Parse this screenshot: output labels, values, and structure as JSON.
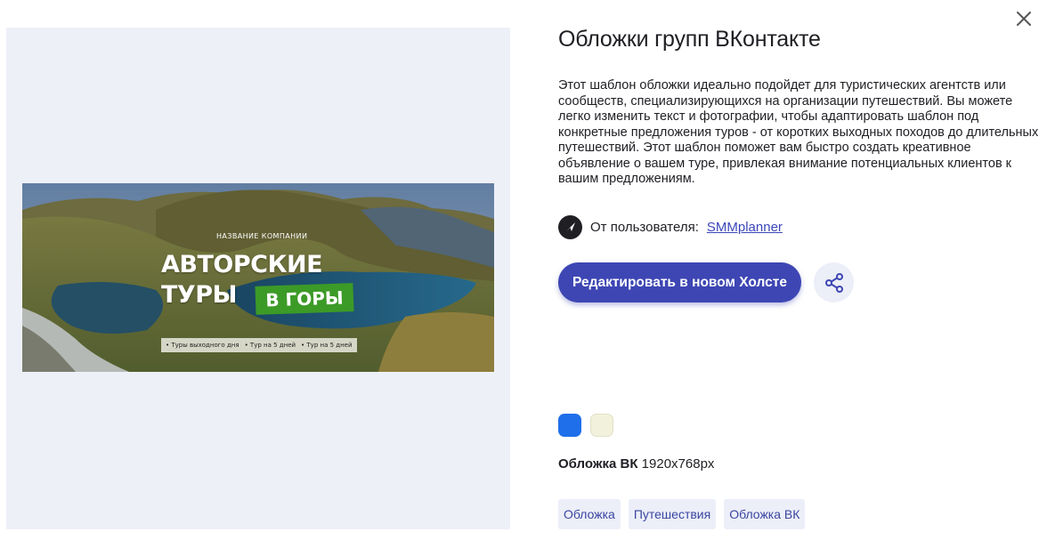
{
  "preview": {
    "company_name": "НАЗВАНИЕ КОМПАНИИ",
    "headline_line1": "АВТОРСКИЕ",
    "headline_line2": "ТУРЫ",
    "badge": "В ГОРЫ",
    "chips": [
      "• Туры выходного дня",
      "• Тур на 5 дней",
      "• Тур на 5 дней"
    ]
  },
  "details": {
    "title": "Обложки групп ВКонтакте",
    "description": "Этот шаблон обложки идеально подойдет для туристических агентств или сообществ, специализирующихся на организации путешествий. Вы можете легко изменить текст и фотографии, чтобы адаптировать шаблон под конкретные предложения туров - от коротких выходных походов до длительных путешествий. Этот шаблон поможет вам быстро создать креативное объявление о вашем туре, привлекая внимание потенциальных клиентов к вашим предложениям.",
    "author_prefix": "От пользователя:",
    "author_name": "SMMplanner",
    "edit_button": "Редактировать в новом Холсте",
    "colors": [
      "#1f6fea",
      "#f2f2dc"
    ],
    "format_name": "Обложка ВК",
    "format_size": "1920x768px",
    "tags": [
      "Обложка",
      "Путешествия",
      "Обложка ВК"
    ]
  },
  "icons": {
    "close": "close-icon",
    "share": "share-icon",
    "author": "paper-plane-icon"
  }
}
